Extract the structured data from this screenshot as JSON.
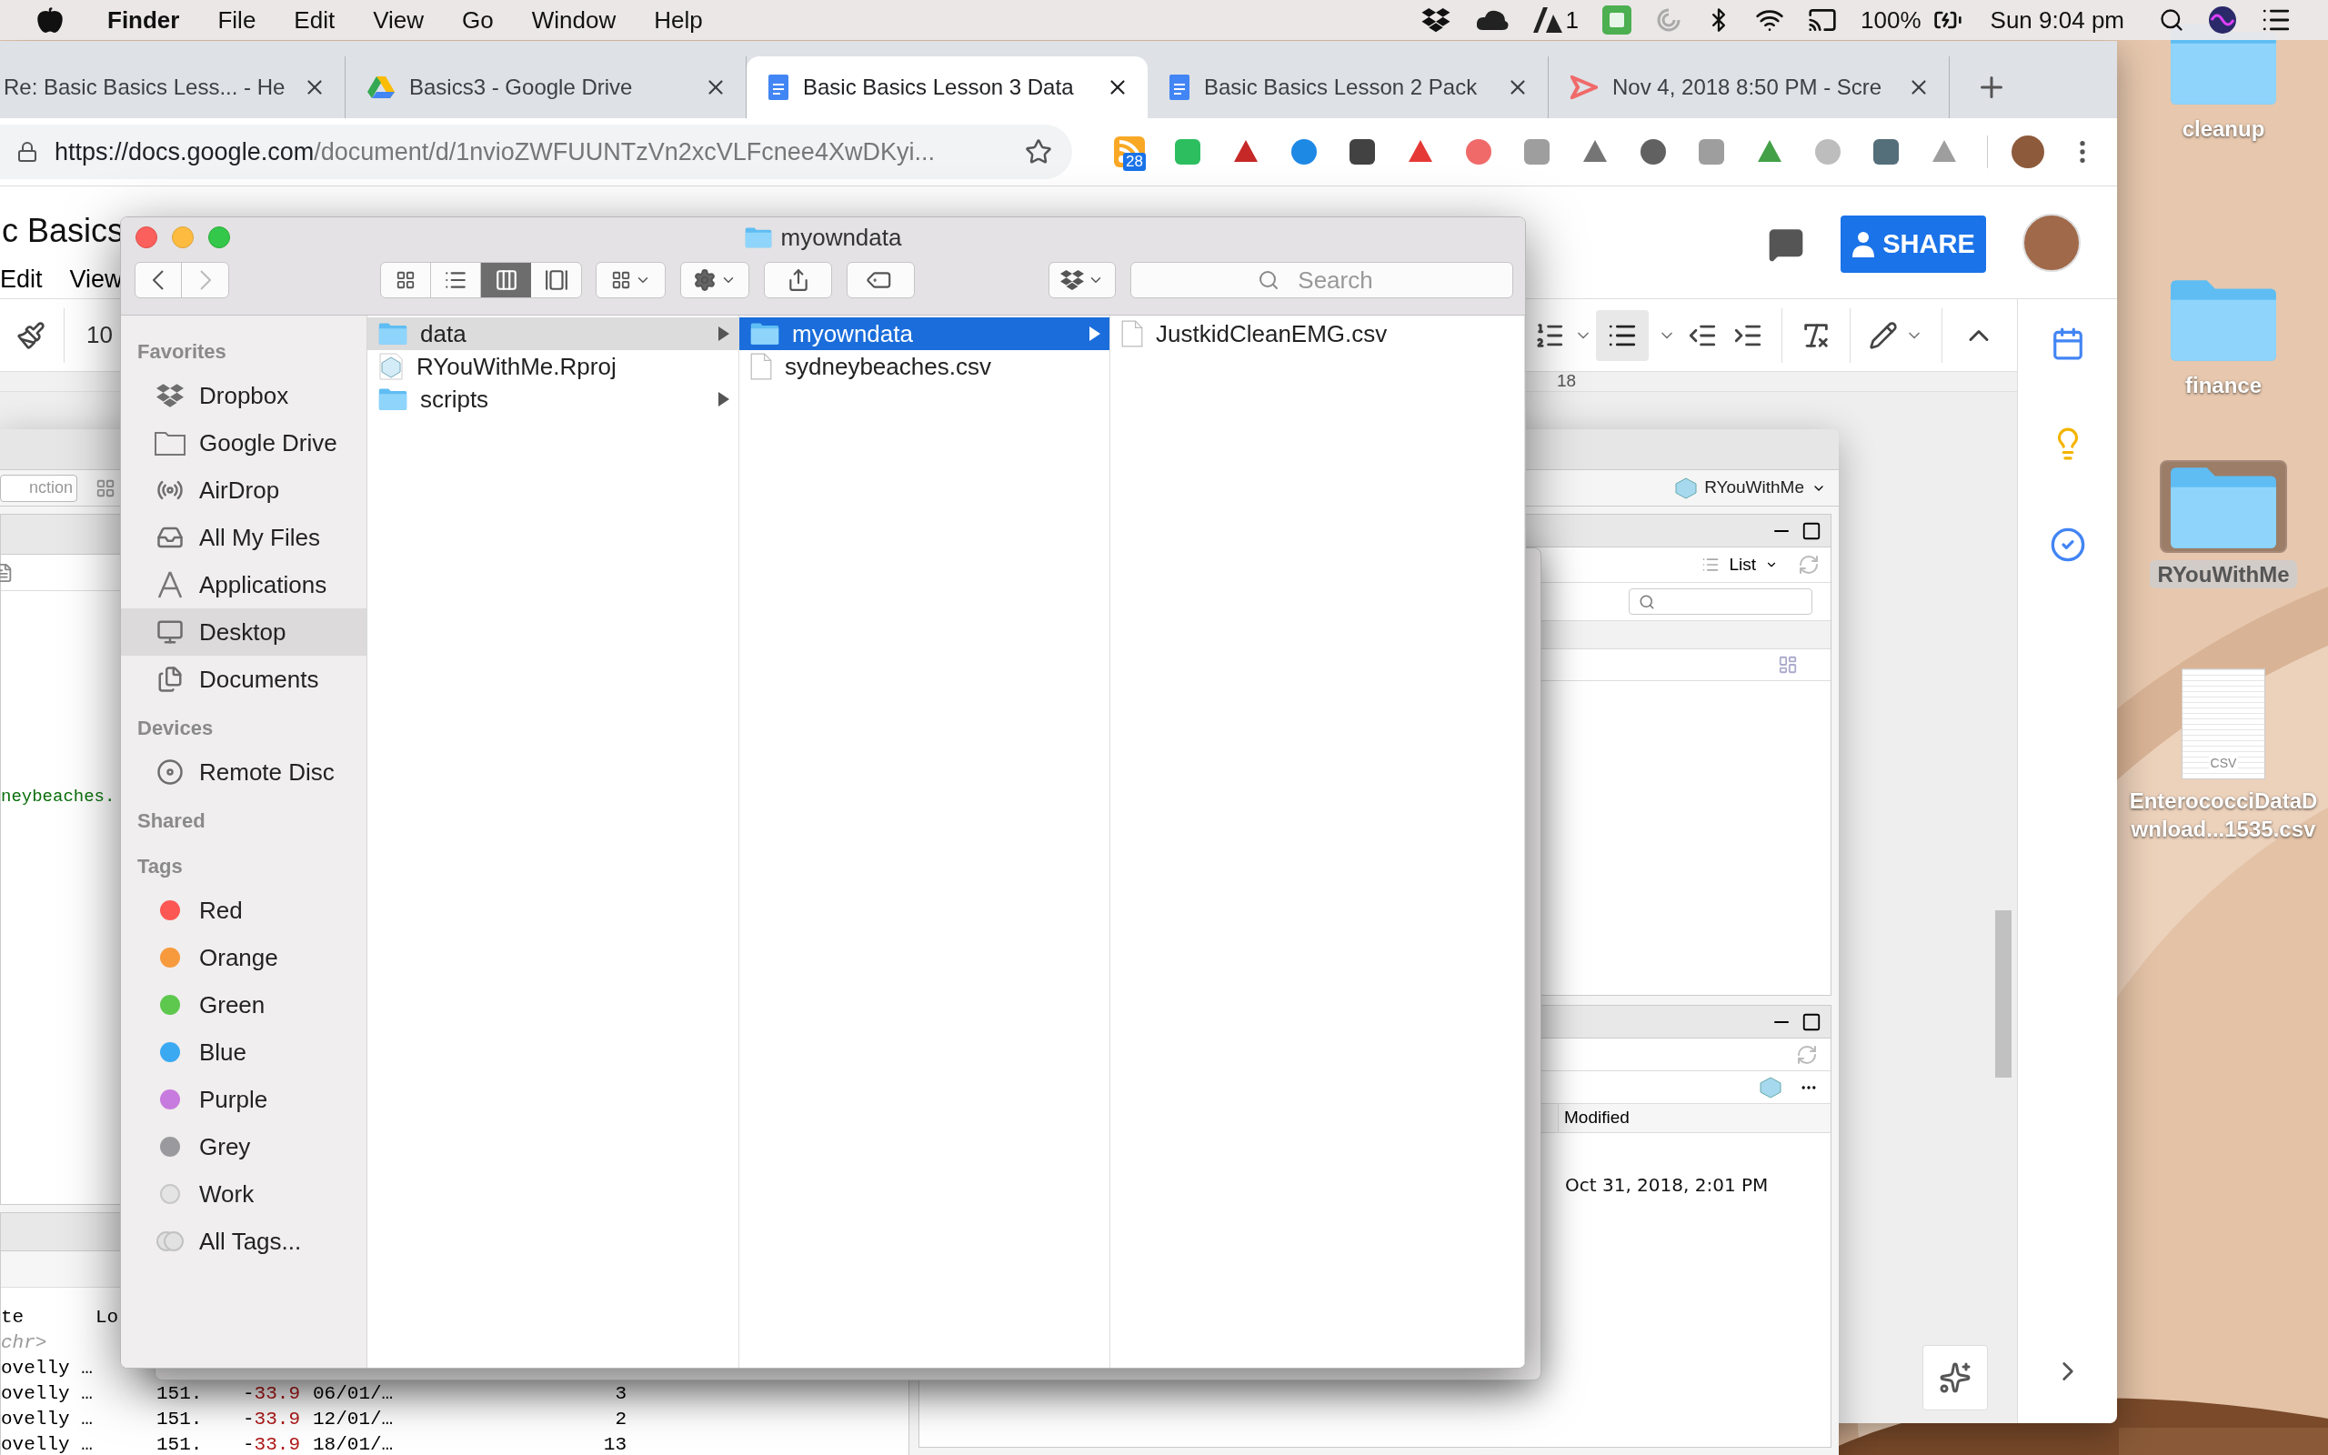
{
  "menu_bar": {
    "app": "Finder",
    "menus": [
      "File",
      "Edit",
      "View",
      "Go",
      "Window",
      "Help"
    ],
    "adobe_count": "1",
    "battery": "100%",
    "clock": "Sun 9:04 pm"
  },
  "browser": {
    "tabs": [
      {
        "title": "Re: Basic Basics Less... - He",
        "selected": false
      },
      {
        "title": "Basics3 - Google Drive",
        "kind": "drive",
        "selected": false
      },
      {
        "title": "Basic Basics Lesson 3 Data",
        "kind": "docs",
        "selected": true
      },
      {
        "title": "Basic Basics Lesson 2 Pack",
        "kind": "docs",
        "selected": false
      },
      {
        "title": "Nov 4, 2018 8:50 PM - Scre",
        "kind": "screencast",
        "selected": false
      }
    ],
    "url_host": "https://docs.google.com",
    "url_path": "/document/d/1nvioZWFUUNTzVn2xcVLFcnee4XwDKyi...",
    "feed_badge": "28",
    "doc": {
      "title": "c Basics",
      "menus": [
        "Edit",
        "View"
      ],
      "zoom": "10",
      "share": "SHARE",
      "ruler": "18"
    }
  },
  "rstudio": {
    "goto_field": "nction",
    "code": "neybeaches.",
    "project": "RYouWithMe",
    "env_view": "List",
    "files_column": "Modified",
    "file_modified": "Oct 31, 2018, 2:01 PM",
    "console_headers": [
      "te",
      "Lo"
    ],
    "console_type": "chr>",
    "console_rows": [
      {
        "name": "ovelly …"
      },
      {
        "name": "ovelly …",
        "lon": "151.",
        "lat_sign": "-",
        "lat": "33.9",
        "date": "06/01/…",
        "count": "3"
      },
      {
        "name": "ovelly …",
        "lon": "151.",
        "lat_sign": "-",
        "lat": "33.9",
        "date": "12/01/…",
        "count": "2"
      },
      {
        "name": "ovelly …",
        "lon": "151.",
        "lat_sign": "-",
        "lat": "33.9",
        "date": "18/01/…",
        "count": "13"
      }
    ]
  },
  "finder": {
    "title": "myowndata",
    "search_placeholder": "Search",
    "sidebar": [
      {
        "heading": "Favorites",
        "items": [
          {
            "label": "Dropbox",
            "kind": "dropbox",
            "selected": false
          },
          {
            "label": "Google Drive",
            "kind": "folder",
            "selected": false
          },
          {
            "label": "AirDrop",
            "kind": "airdrop",
            "selected": false
          },
          {
            "label": "All My Files",
            "kind": "files",
            "selected": false
          },
          {
            "label": "Applications",
            "kind": "apps",
            "selected": false
          },
          {
            "label": "Desktop",
            "kind": "desktop",
            "selected": true
          },
          {
            "label": "Documents",
            "kind": "documents",
            "selected": false
          }
        ]
      },
      {
        "heading": "Devices",
        "items": [
          {
            "label": "Remote Disc",
            "kind": "disc",
            "selected": false
          }
        ]
      },
      {
        "heading": "Shared"
      },
      {
        "heading": "Tags",
        "items": [
          {
            "label": "Red",
            "kind": "tag",
            "color": "#fc5753",
            "selected": false
          },
          {
            "label": "Orange",
            "kind": "tag",
            "color": "#f79a3e",
            "selected": false
          },
          {
            "label": "Green",
            "kind": "tag",
            "color": "#5ec84e",
            "selected": false
          },
          {
            "label": "Blue",
            "kind": "tag",
            "color": "#3ba9f2",
            "selected": false
          },
          {
            "label": "Purple",
            "kind": "tag",
            "color": "#c87bde",
            "selected": false
          },
          {
            "label": "Grey",
            "kind": "tag",
            "color": "#9a9a9e",
            "selected": false
          },
          {
            "label": "Work",
            "kind": "plain-tag",
            "selected": false
          },
          {
            "label": "All Tags...",
            "kind": "all-tags",
            "selected": false
          }
        ]
      }
    ],
    "columns": [
      {
        "focused": false,
        "items": [
          {
            "name": "data",
            "kind": "folder",
            "has_children": true,
            "selected": true
          },
          {
            "name": "RYouWithMe.Rproj",
            "kind": "rproj",
            "selected": false
          },
          {
            "name": "scripts",
            "kind": "folder",
            "has_children": true,
            "selected": false
          }
        ]
      },
      {
        "focused": true,
        "items": [
          {
            "name": "myowndata",
            "kind": "folder",
            "has_children": true,
            "selected": true
          },
          {
            "name": "sydneybeaches.csv",
            "kind": "file",
            "selected": false
          }
        ]
      },
      {
        "items": [
          {
            "name": "JustkidCleanEMG.csv",
            "kind": "file",
            "selected": false
          }
        ]
      }
    ]
  },
  "desktop": [
    {
      "label_lines": [
        "cleanup"
      ],
      "kind": "folder",
      "selected": false
    },
    {
      "label_lines": [
        "finance"
      ],
      "kind": "folder",
      "selected": false
    },
    {
      "label_lines": [
        "RYouWithMe"
      ],
      "kind": "folder",
      "selected": true
    },
    {
      "label_lines": [
        "EnterococciDataD",
        "wnload...1535.csv"
      ],
      "kind": "csv",
      "file_type": "CSV",
      "selected": false
    }
  ]
}
